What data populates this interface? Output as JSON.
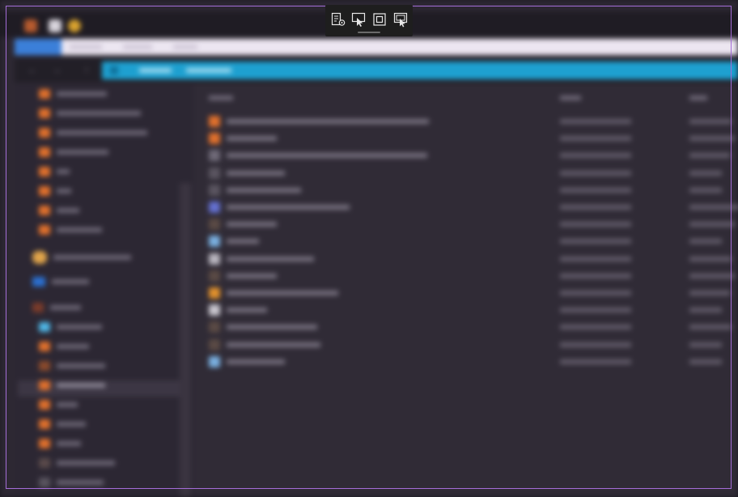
{
  "snip_toolbar": {
    "buttons": [
      {
        "id": "freeform",
        "icon": "freeform-snip-icon"
      },
      {
        "id": "window",
        "icon": "window-snip-icon"
      },
      {
        "id": "rectangle",
        "icon": "rectangle-snip-icon"
      },
      {
        "id": "fullscreen",
        "icon": "fullscreen-snip-icon"
      }
    ]
  },
  "colors": {
    "frame": "#a46cd8",
    "toolbar_bg": "#1e1e1e",
    "address_bar": "#1ea0d0",
    "ribbon_active": "#3b7fd9",
    "folder_icon": "#e0702c"
  }
}
